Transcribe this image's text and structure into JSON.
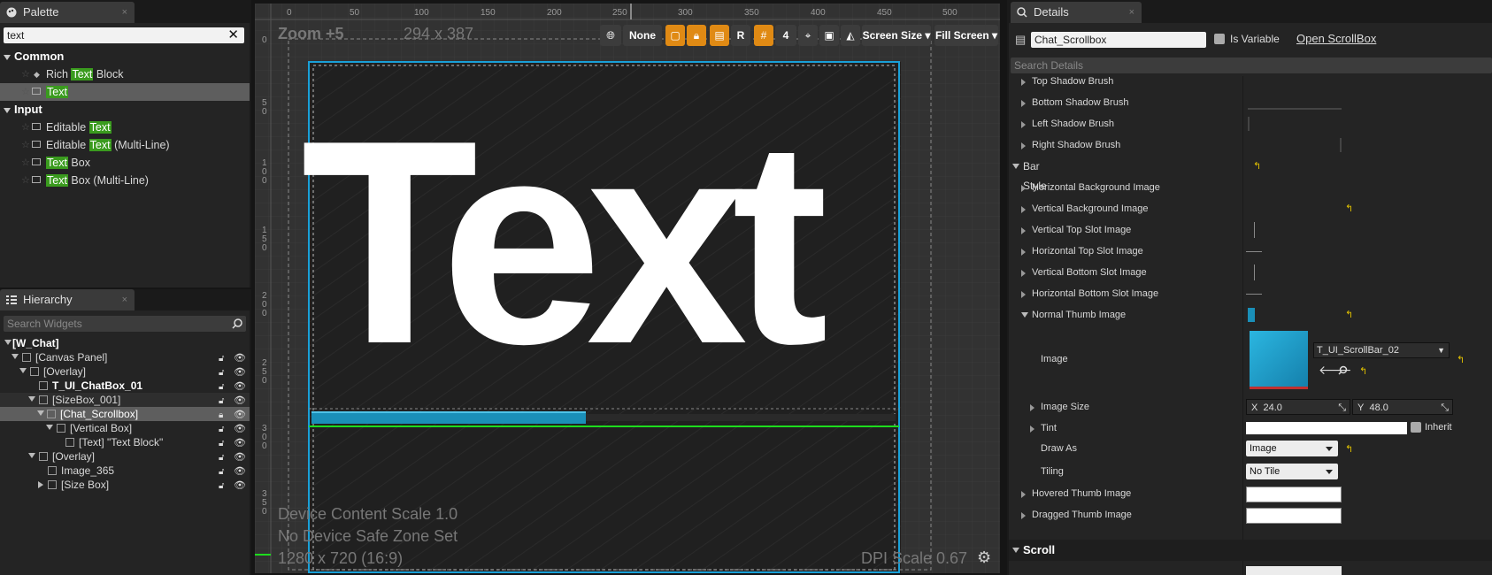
{
  "palette": {
    "tab_label": "Palette",
    "close": "×",
    "search_value": "text",
    "categories": [
      {
        "label": "Common",
        "items": [
          {
            "pre": "Rich ",
            "match": "Text",
            "post": " Block"
          },
          {
            "pre": "",
            "match": "Text",
            "post": ""
          }
        ]
      },
      {
        "label": "Input",
        "items": [
          {
            "pre": "Editable ",
            "match": "Text",
            "post": ""
          },
          {
            "pre": "Editable ",
            "match": "Text",
            "post": " (Multi-Line)"
          },
          {
            "pre": "",
            "match": "Text",
            "post": " Box"
          },
          {
            "pre": "",
            "match": "Text",
            "post": " Box (Multi-Line)"
          }
        ]
      }
    ]
  },
  "hierarchy": {
    "tab_label": "Hierarchy",
    "close": "×",
    "search_placeholder": "Search Widgets",
    "rows": [
      {
        "label": "[W_Chat]"
      },
      {
        "label": "[Canvas Panel]"
      },
      {
        "label": "[Overlay]"
      },
      {
        "label": "T_UI_ChatBox_01"
      },
      {
        "label": "[SizeBox_001]"
      },
      {
        "label": "[Chat_Scrollbox]"
      },
      {
        "label": "[Vertical Box]"
      },
      {
        "label": "[Text] \"Text Block\""
      },
      {
        "label": "[Overlay]"
      },
      {
        "label": "Image_365"
      },
      {
        "label": "[Size Box]"
      }
    ]
  },
  "canvas": {
    "zoom_label": "Zoom +5",
    "size_label": "294 x 387",
    "ruler_x": [
      "0",
      "50",
      "100",
      "150",
      "200",
      "250",
      "300",
      "350",
      "400",
      "450",
      "500"
    ],
    "ruler_y": [
      "0",
      "5\n0",
      "1\n0\n0",
      "1\n5\n0",
      "2\n0\n0",
      "2\n5\n0",
      "3\n0\n0",
      "3\n5\n0"
    ],
    "toolbar": {
      "none_label": "None",
      "r_label": "R",
      "grid_value": "4",
      "screen_size_label": "Screen Size",
      "fill_screen_label": "Fill Screen"
    },
    "big_text": "Text",
    "device_content_scale": "Device Content Scale 1.0",
    "safe_zone": "No Device Safe Zone Set",
    "resolution": "1280 x 720 (16:9)",
    "dpi_scale": "DPI Scale 0.67"
  },
  "details": {
    "tab_label": "Details",
    "close": "×",
    "name_value": "Chat_Scrollbox",
    "is_variable_label": "Is Variable",
    "open_scrollbox_label": "Open ScrollBox",
    "search_placeholder": "Search Details",
    "top_rows": [
      "Top Shadow Brush",
      "Bottom Shadow Brush",
      "Left Shadow Brush",
      "Right Shadow Brush"
    ],
    "bar_style_label": "Bar Style",
    "bar_rows": [
      "Horizontal Background Image",
      "Vertical Background Image",
      "Vertical Top Slot Image",
      "Horizontal Top Slot Image",
      "Vertical Bottom Slot Image",
      "Horizontal Bottom Slot Image",
      "Normal Thumb Image"
    ],
    "image_label": "Image",
    "image_asset": "T_UI_ScrollBar_02",
    "image_size_label": "Image Size",
    "image_size_x_label": "X",
    "image_size_x": "24.0",
    "image_size_y_label": "Y",
    "image_size_y": "48.0",
    "tint_label": "Tint",
    "inherit_label": "Inherit",
    "draw_as_label": "Draw As",
    "draw_as_value": "Image",
    "tiling_label": "Tiling",
    "tiling_value": "No Tile",
    "hovered_label": "Hovered Thumb Image",
    "dragged_label": "Dragged Thumb Image",
    "scroll_label": "Scroll"
  },
  "colors": {
    "highlight": "#3a9b1e",
    "selection_blue": "#19a0d8",
    "toolbar_orange": "#e08a14",
    "thumb_blue": "#1a8fb8"
  }
}
